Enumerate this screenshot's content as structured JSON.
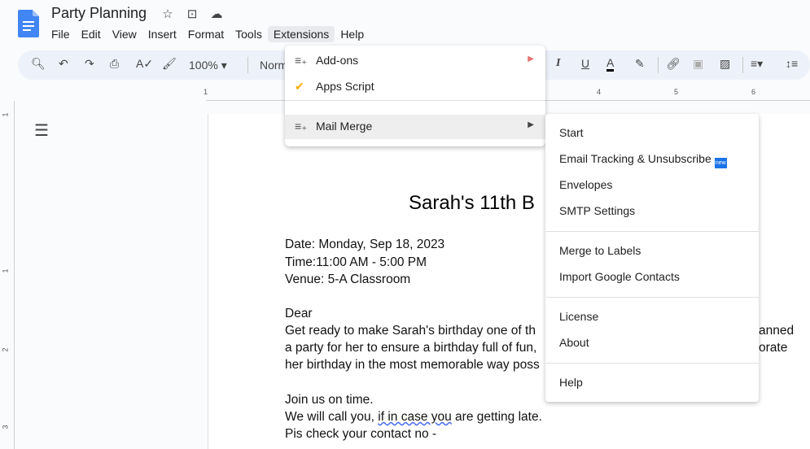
{
  "doc_title": "Party Planning",
  "menubar": [
    "File",
    "Edit",
    "View",
    "Insert",
    "Format",
    "Tools",
    "Extensions",
    "Help"
  ],
  "toolbar": {
    "zoom": "100%",
    "style": "Norm"
  },
  "ruler": [
    "1",
    "4",
    "5",
    "6"
  ],
  "vruler": [
    "1",
    "1",
    "2",
    "3"
  ],
  "extensions_menu": {
    "items": [
      {
        "label": "Add-ons",
        "icon": "add-ons-icon",
        "has_submenu": true
      },
      {
        "label": "Apps Script",
        "icon": "apps-script-icon",
        "has_submenu": false
      },
      {
        "label": "Mail Merge",
        "icon": "mail-merge-icon",
        "has_submenu": true
      }
    ]
  },
  "mail_merge_submenu": {
    "items": [
      "Start",
      "Email Tracking & Unsubscribe",
      "Envelopes",
      "SMTP Settings",
      "Merge to Labels",
      "Import Google Contacts",
      "License",
      "About",
      "Help"
    ],
    "badge": "new"
  },
  "document": {
    "heading": "Sarah's 11th B",
    "date": "Date: Monday, Sep 18, 2023",
    "time": "Time:11:00 AM - 5:00 PM",
    "venue": "Venue: 5-A Classroom",
    "dear": "Dear",
    "p1_l1": "Get ready to make Sarah's birthday one of th",
    "p1_l1_end": "anned",
    "p1_l2": "a party for her to ensure a birthday full of fun,",
    "p1_l2_end": "orate",
    "p1_l3": "her birthday in the most memorable way poss",
    "join": "Join us on time.",
    "call_pre": "We will call you, ",
    "call_link": "if in case you",
    "call_post": " are getting late.",
    "contact": "Pis check your contact no -"
  },
  "colors": {
    "accent": "#1a73e8",
    "toolbar_bg": "#edf2fa",
    "page_bg": "#f9fbfd"
  }
}
